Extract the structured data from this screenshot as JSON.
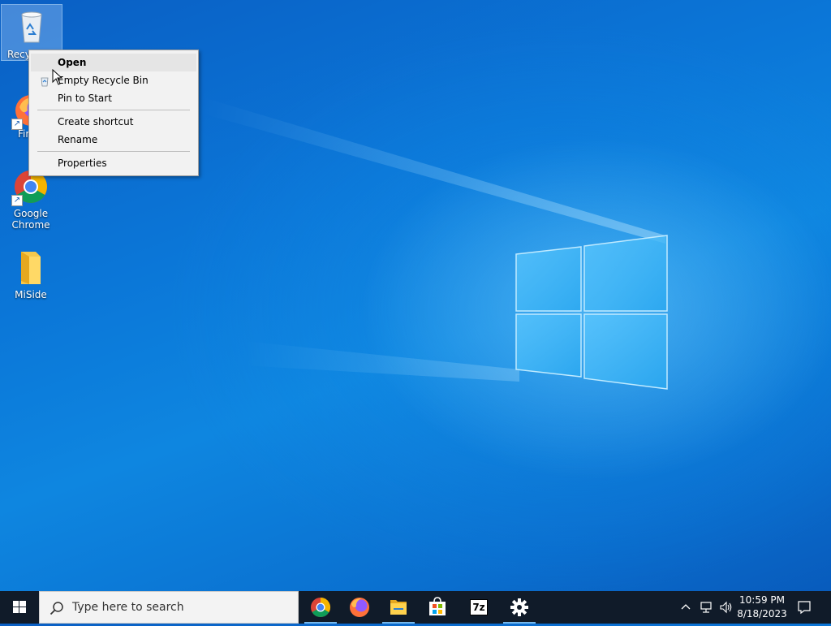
{
  "desktop": {
    "icons": [
      {
        "label": "Recy",
        "icon": "recycle-bin-icon"
      },
      {
        "label": "Fir",
        "icon": "firefox-icon"
      },
      {
        "label": "Google Chrome",
        "icon": "chrome-icon"
      },
      {
        "label": "MiSide",
        "icon": "folder-icon"
      }
    ]
  },
  "context_menu": {
    "items": [
      {
        "label": "Open"
      },
      {
        "label": "Empty Recycle Bin"
      },
      {
        "label": "Pin to Start"
      },
      {
        "label": "Create shortcut"
      },
      {
        "label": "Rename"
      },
      {
        "label": "Properties"
      }
    ]
  },
  "taskbar": {
    "search_placeholder": "Type here to search",
    "pinned_apps": [
      "chrome-icon",
      "firefox-icon",
      "file-explorer-icon",
      "microsoft-store-icon",
      "7zip-icon",
      "settings-icon"
    ],
    "seven_zip_label": "7z",
    "clock": {
      "time": "10:59 PM",
      "date": "8/18/2023"
    }
  },
  "colors": {
    "accent": "#0078d7",
    "taskbar": "#101b29",
    "menu_bg": "#f2f2f2"
  }
}
